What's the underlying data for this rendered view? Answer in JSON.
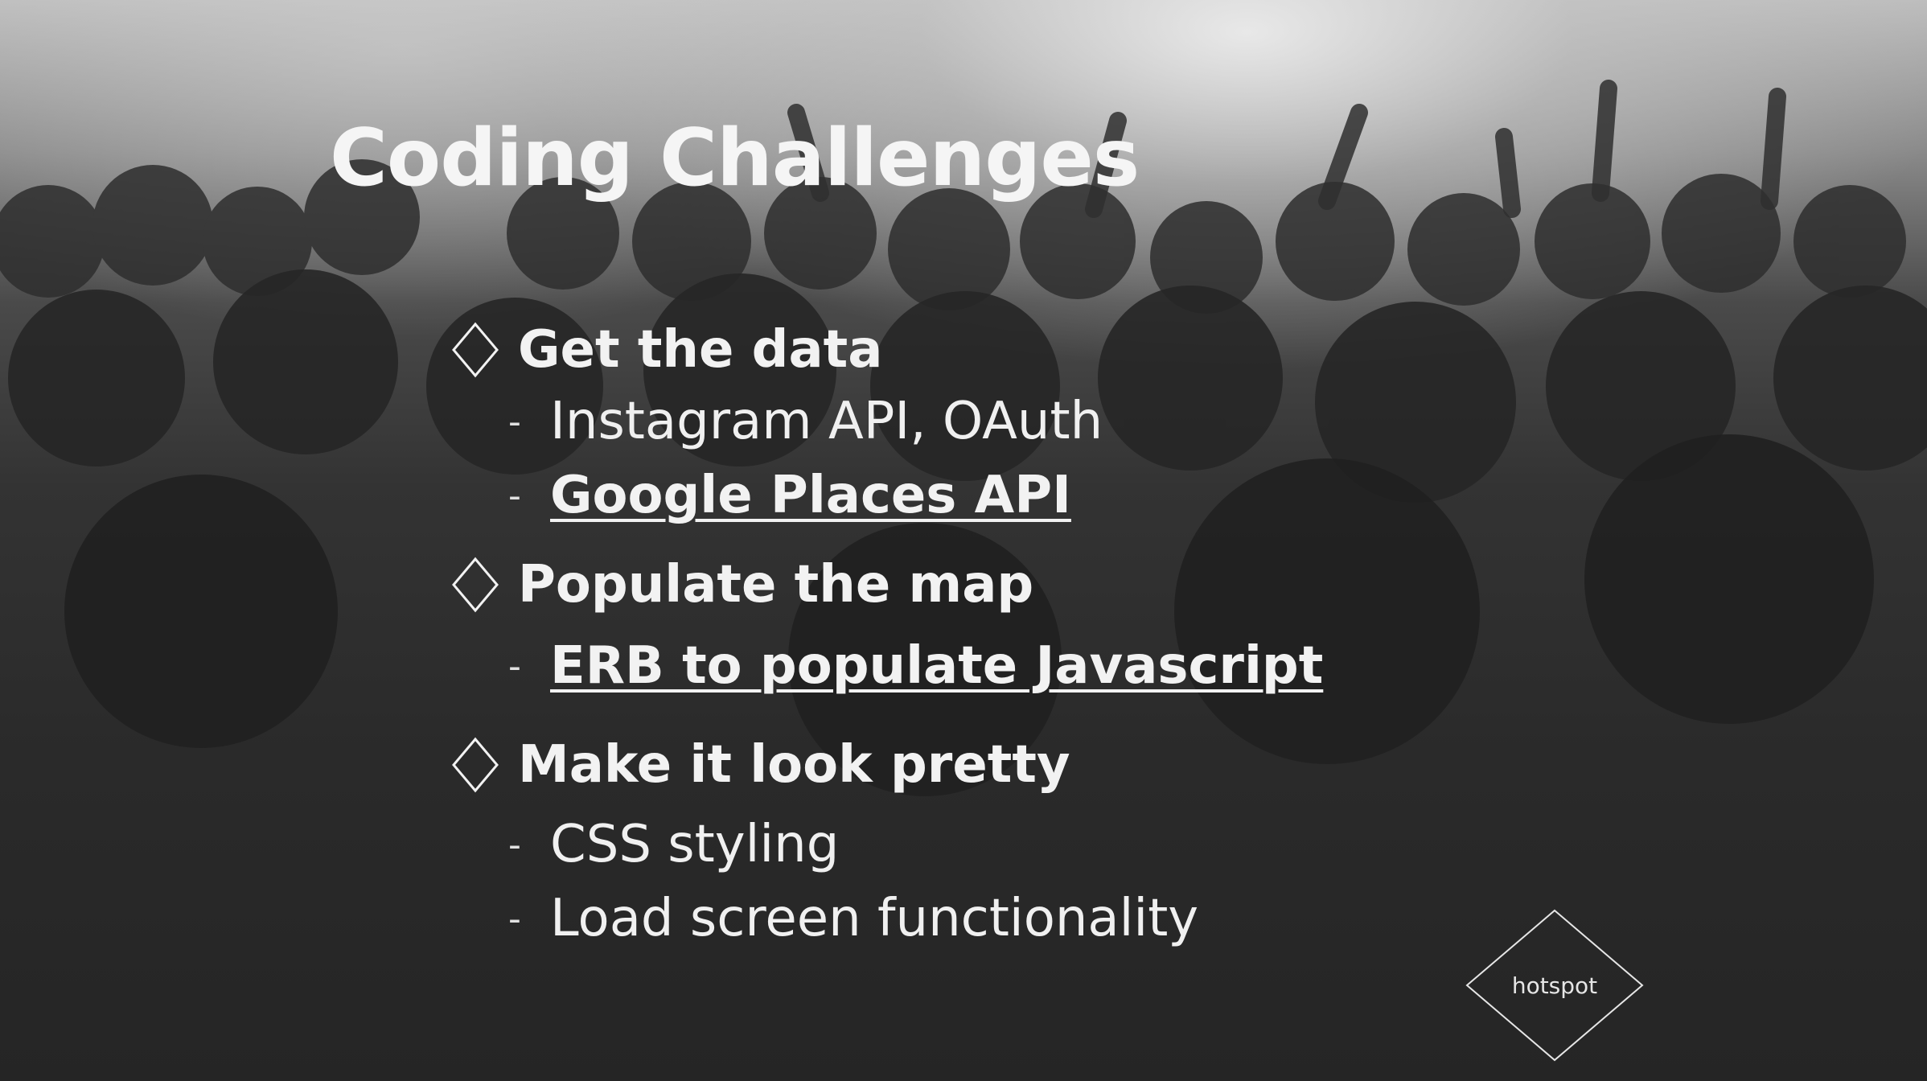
{
  "slide": {
    "title": "Coding Challenges",
    "sections": [
      {
        "heading": "Get the data",
        "items": [
          {
            "text": "Instagram API, OAuth",
            "link": false
          },
          {
            "text": "Google Places API",
            "link": true
          }
        ]
      },
      {
        "heading": "Populate the map",
        "items": [
          {
            "text": "ERB to populate Javascript",
            "link": true
          }
        ]
      },
      {
        "heading": "Make it look pretty",
        "items": [
          {
            "text": "CSS styling",
            "link": false
          },
          {
            "text": "Load screen functionality",
            "link": false
          }
        ]
      }
    ],
    "dash": "-",
    "logo_text": "hotspot",
    "bullet_icon": "diamond-outline-icon",
    "colors": {
      "text": "#f2f2f2",
      "background_dark": "#252525",
      "background_light": "#bdbdbd"
    }
  }
}
